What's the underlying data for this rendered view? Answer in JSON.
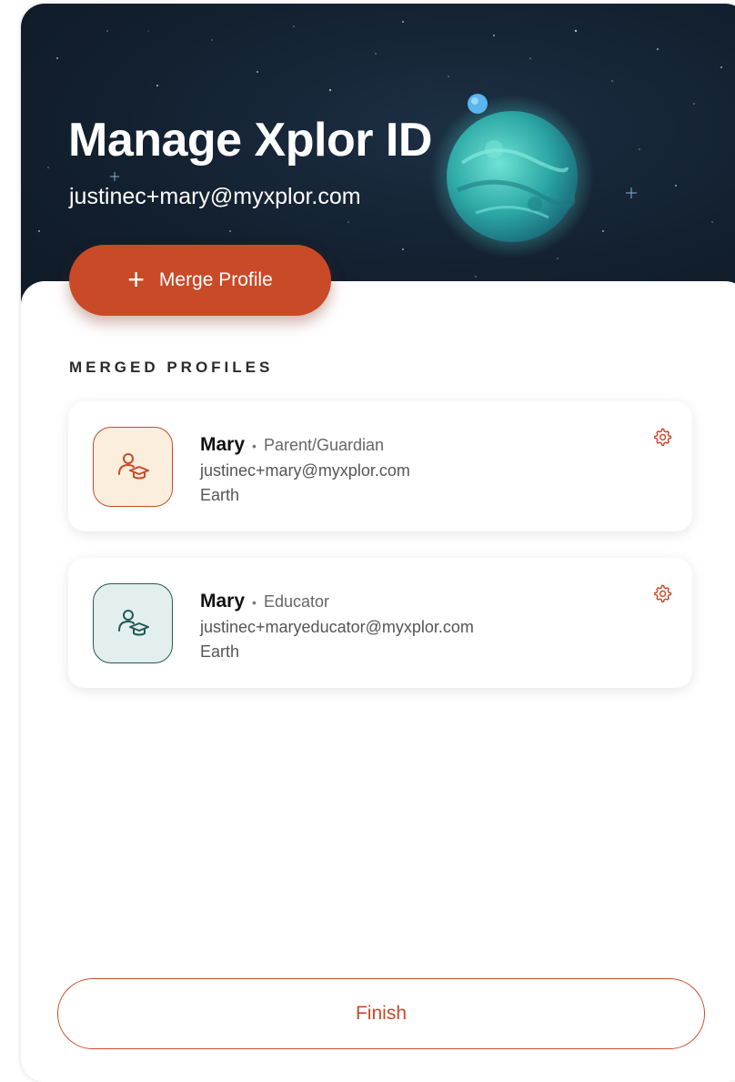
{
  "header": {
    "title": "Manage Xplor ID",
    "email": "justinec+mary@myxplor.com"
  },
  "merge_button": {
    "label": "Merge Profile",
    "icon": "plus-icon"
  },
  "merged_profiles": {
    "heading": "MERGED PROFILES",
    "items": [
      {
        "name": "Mary",
        "role": "Parent/Guardian",
        "email": "justinec+mary@myxplor.com",
        "location": "Earth",
        "icon": "user-graduate-icon",
        "accent": "#c94a27"
      },
      {
        "name": "Mary",
        "role": "Educator",
        "email": "justinec+maryeducator@myxplor.com",
        "location": "Earth",
        "icon": "user-graduate-icon",
        "accent": "#1f5a52"
      }
    ]
  },
  "finish_button": {
    "label": "Finish"
  },
  "colors": {
    "brand": "#c94a27",
    "educator": "#1f5a52",
    "hero_bg": "#13202f"
  }
}
